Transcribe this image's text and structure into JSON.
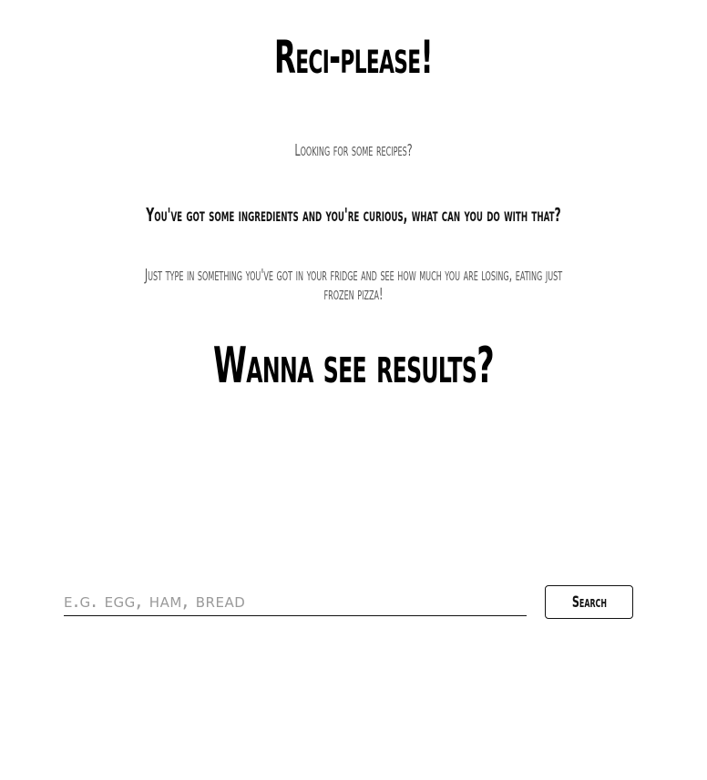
{
  "header": {
    "title": "Reci-please!"
  },
  "intro": {
    "question": "Looking for some recipes?",
    "ingredients": "You've got some ingredients and you're curious, what can you do with that?",
    "instructions": "Just type in something you've got in your fridge and see how much you are losing, eating just frozen pizza!"
  },
  "results": {
    "heading": "Wanna see results?"
  },
  "search": {
    "placeholder": "e.g. egg, ham, bread",
    "value": "",
    "button_label": "Search"
  }
}
